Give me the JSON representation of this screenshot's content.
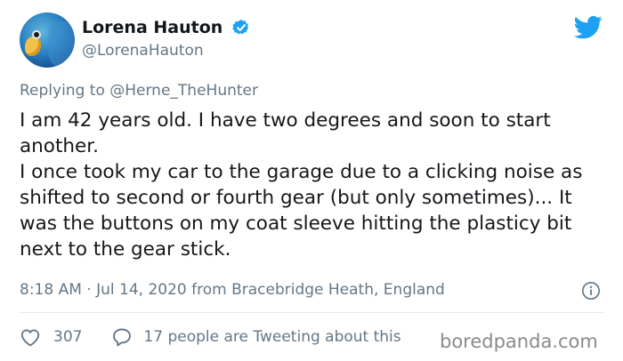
{
  "tweet": {
    "author_name": "Lorena Hauton",
    "author_handle": "@LorenaHauton",
    "replying_to_label": "Replying to",
    "replying_to_handle": "@Herne_TheHunter",
    "lines": [
      "I am 42 years old. I have two degrees and soon to start another.",
      "I once took my car to the garage due to a clicking noise as shifted to second or fourth gear (but only sometimes)... It was the buttons on my coat sleeve hitting the plasticy bit next to the gear stick."
    ],
    "timestamp_location": "8:18 AM · Jul 14, 2020 from Bracebridge Heath, England",
    "like_count": "307",
    "talk_text": "17 people are Tweeting about this"
  },
  "icons": {
    "verified": "verified-badge-icon",
    "brand": "twitter-bird-icon",
    "info": "info-icon",
    "like": "heart-icon",
    "reply": "comment-icon"
  },
  "colors": {
    "accent": "#1da1f2",
    "text": "#14171a",
    "secondary": "#657786",
    "divider": "#e1e8ed"
  },
  "watermark": "boredpanda.com"
}
